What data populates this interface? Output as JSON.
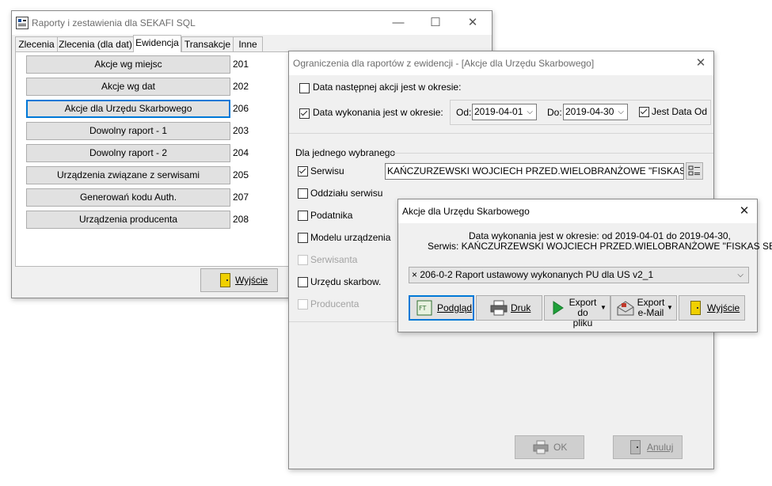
{
  "main_window": {
    "title": "Raporty i zestawienia dla SEKAFI SQL",
    "tabs": [
      "Zlecenia",
      "Zlecenia (dla dat)",
      "Ewidencja",
      "Transakcje",
      "Inne"
    ],
    "active_tab": "Ewidencja",
    "reports": [
      {
        "label": "Akcje wg miejsc",
        "code": "201"
      },
      {
        "label": "Akcje wg dat",
        "code": "202"
      },
      {
        "label": "Akcje dla Urzędu Skarbowego",
        "code": "206"
      },
      {
        "label": "Dowolny raport - 1",
        "code": "203"
      },
      {
        "label": "Dowolny raport - 2",
        "code": "204"
      },
      {
        "label": "Urządzenia związane z serwisami",
        "code": "205"
      },
      {
        "label": "Generowań kodu Auth.",
        "code": "207"
      },
      {
        "label": "Urządzenia producenta",
        "code": "208"
      }
    ],
    "exit_label": "Wyjście"
  },
  "restrictions_window": {
    "title": "Ograniczenia dla raportów z ewidencji - [Akcje dla Urzędu Skarbowego]",
    "next_action_label": "Data następnej akcji jest w okresie:",
    "next_action_checked": false,
    "executed_label": "Data wykonania jest w okresie:",
    "executed_checked": true,
    "from_label": "Od:",
    "from_value": "2019-04-01",
    "to_label": "Do:",
    "to_value": "2019-04-30",
    "same_date_label": "Jest Data Od",
    "same_date_checked": true,
    "section_title": "Dla jednego wybranego",
    "filters": [
      {
        "label": "Serwisu",
        "checked": true,
        "enabled": true
      },
      {
        "label": "Oddziału serwisu",
        "checked": false,
        "enabled": true
      },
      {
        "label": "Podatnika",
        "checked": false,
        "enabled": true
      },
      {
        "label": "Modelu urządzenia",
        "checked": false,
        "enabled": true
      },
      {
        "label": "Serwisanta",
        "checked": false,
        "enabled": false
      },
      {
        "label": "Urzędu skarbow.",
        "checked": false,
        "enabled": true
      },
      {
        "label": "Producenta",
        "checked": false,
        "enabled": false
      }
    ],
    "service_value": "KAŃCZURZEWSKI WOJCIECH PRZED.WIELOBRANŻOWE \"FISKAS SERV",
    "ok_label": "OK",
    "cancel_label": "Anuluj"
  },
  "dialog": {
    "title": "Akcje dla Urzędu Skarbowego",
    "info_line1": "Data wykonania jest w okresie:  od 2019-04-01  do 2019-04-30,",
    "info_line2": "Serwis: KAŃCZURZEWSKI WOJCIECH PRZED.WIELOBRANŻOWE \"FISKAS SERVICE\"",
    "report_select": "× 206-0-2 Raport ustawowy wykonanych PU dla US v2_1",
    "buttons": {
      "preview": "Podgląd",
      "print": "Druk",
      "export_file_1": "Export",
      "export_file_2": "do pliku",
      "export_mail_1": "Export",
      "export_mail_2": "e-Mail",
      "exit": "Wyjście"
    }
  }
}
